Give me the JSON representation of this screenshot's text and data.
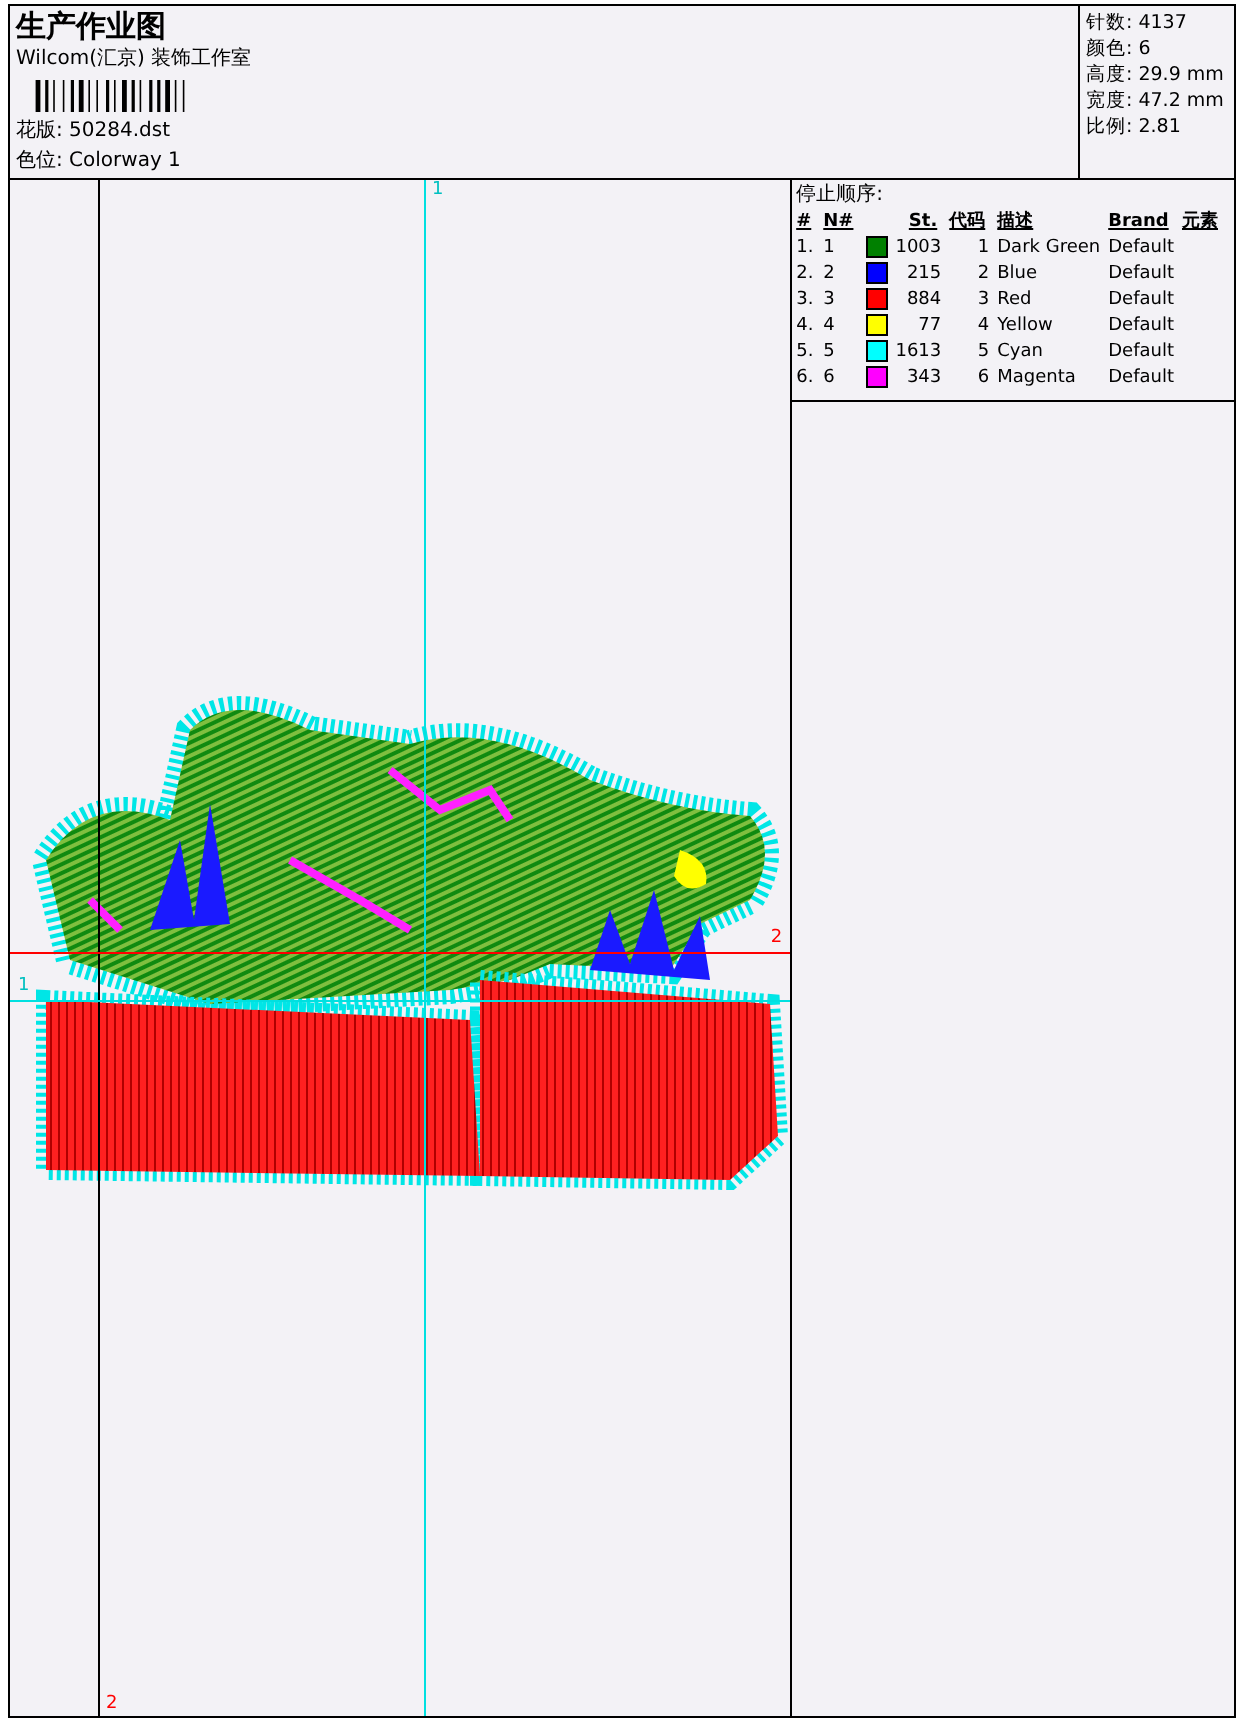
{
  "header": {
    "title": "生产作业图",
    "studio": "Wilcom(汇京) 装饰工作室",
    "design_file": "花版: 50284.dst",
    "colorway": "色位: Colorway 1"
  },
  "stats": [
    "针数: 4137",
    "颜色: 6",
    "高度: 29.9 mm",
    "宽度: 47.2 mm",
    "比例: 2.81"
  ],
  "stop_sequence": {
    "title": "停止顺序:",
    "columns": [
      "#",
      "N#",
      "",
      "St.",
      "代码",
      "描述",
      "Brand",
      "元素"
    ],
    "rows": [
      {
        "index": "1.",
        "number": "1",
        "color": "#008000",
        "stitches": "1003",
        "code": "1",
        "description": "Dark Green",
        "brand": "Default"
      },
      {
        "index": "2.",
        "number": "2",
        "color": "#0000ff",
        "stitches": "215",
        "code": "2",
        "description": "Blue",
        "brand": "Default"
      },
      {
        "index": "3.",
        "number": "3",
        "color": "#ff0000",
        "stitches": "884",
        "code": "3",
        "description": "Red",
        "brand": "Default"
      },
      {
        "index": "4.",
        "number": "4",
        "color": "#ffff00",
        "stitches": "77",
        "code": "4",
        "description": "Yellow",
        "brand": "Default"
      },
      {
        "index": "5.",
        "number": "5",
        "color": "#00ffff",
        "stitches": "1613",
        "code": "5",
        "description": "Cyan",
        "brand": "Default"
      },
      {
        "index": "6.",
        "number": "6",
        "color": "#ff00ff",
        "stitches": "343",
        "code": "6",
        "description": "Magenta",
        "brand": "Default"
      }
    ]
  },
  "guides": [
    {
      "kind": "vertical",
      "label": "1",
      "color": "#00e0e0"
    },
    {
      "kind": "vertical",
      "label": "2",
      "color": "#000000"
    },
    {
      "kind": "horizontal",
      "label": "2",
      "color": "#ff0000"
    },
    {
      "kind": "horizontal",
      "label": "1",
      "color": "#00e0e0"
    }
  ]
}
